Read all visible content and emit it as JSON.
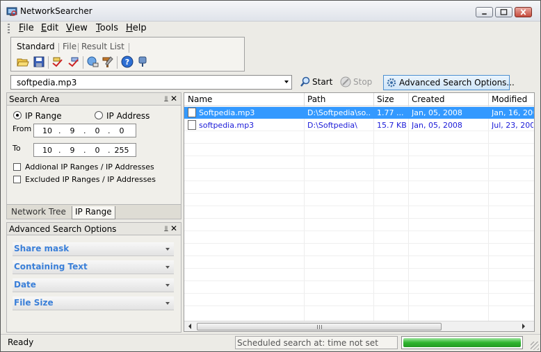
{
  "window": {
    "title": "NetworkSearcher"
  },
  "menu": {
    "items": [
      {
        "label": "File",
        "key": "F",
        "rest": "ile"
      },
      {
        "label": "Edit",
        "key": "E",
        "rest": "dit"
      },
      {
        "label": "View",
        "key": "V",
        "rest": "iew"
      },
      {
        "label": "Tools",
        "key": "T",
        "rest": "ools"
      },
      {
        "label": "Help",
        "key": "H",
        "rest": "elp"
      }
    ]
  },
  "toolbar": {
    "tabs": [
      "Standard",
      "File",
      "Result List"
    ],
    "icons": [
      "open-folder-icon",
      "save-icon",
      "find-icon",
      "find-next-icon",
      "network-icon",
      "tools-icon",
      "help-icon",
      "info-icon"
    ]
  },
  "search": {
    "query": "softpedia.mp3",
    "start_label": "Start",
    "stop_label": "Stop",
    "advanced_label": "Advanced Search Options..."
  },
  "search_area": {
    "title": "Search Area",
    "radio_ip_range": "IP Range",
    "radio_ip_address": "IP Address",
    "from_label": "From",
    "to_label": "To",
    "from_ip": [
      "10",
      "9",
      "0",
      "0"
    ],
    "to_ip": [
      "10",
      "9",
      "0",
      "255"
    ],
    "check_additional": "Addional IP Ranges / IP Addresses",
    "check_excluded": "Excluded IP Ranges / IP Addresses",
    "tabs": [
      "Network Tree",
      "IP Range"
    ]
  },
  "advanced": {
    "title": "Advanced Search Options",
    "items": [
      "Share mask",
      "Containing Text",
      "Date",
      "File Size"
    ]
  },
  "results": {
    "columns": [
      "Name",
      "Path",
      "Size",
      "Created",
      "Modified"
    ],
    "rows": [
      {
        "name": "Softpedia.mp3",
        "path": "D:\\Softpedia\\so...",
        "size": "1.77 ...",
        "created": "Jan, 05, 2008",
        "modified": "Jan, 16, 2007"
      },
      {
        "name": "softpedia.mp3",
        "path": "D:\\Softpedia\\",
        "size": "15.7 KB",
        "created": "Jan, 05, 2008",
        "modified": "Jul, 23, 2007"
      }
    ],
    "scroll_fraction": 0.0
  },
  "status": {
    "ready": "Ready",
    "scheduled": "Scheduled search at:  time not set",
    "progress_percent": 100
  },
  "colors": {
    "accent": "#3399ff",
    "link_text": "#1a1ad8",
    "adv_item_text": "#3a7fd8",
    "progress": "#2fb52f"
  }
}
